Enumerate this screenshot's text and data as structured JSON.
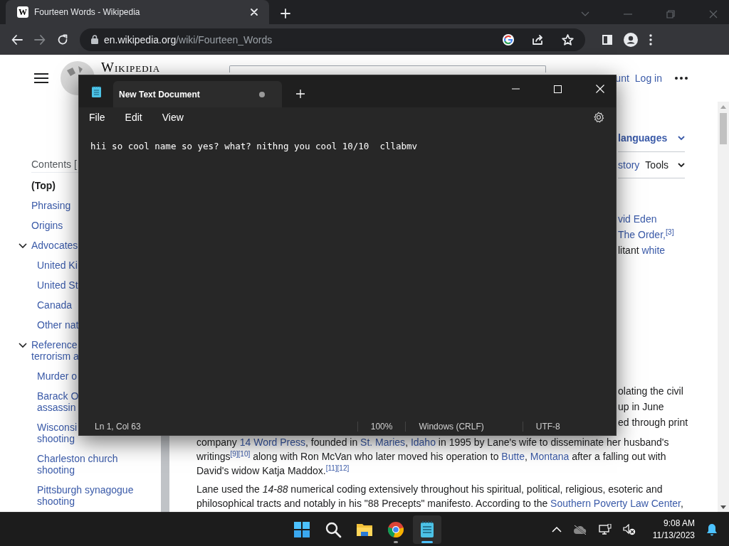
{
  "browser": {
    "tabs": [
      {
        "favicon_letter": "W",
        "title": "Fourteen Words - Wikipedia",
        "selected": true
      }
    ],
    "forward_disabled": true,
    "address": {
      "host": "en.wikipedia.org",
      "path": "/wiki/Fourteen_Words"
    }
  },
  "wiki": {
    "wordmark": "Wikipedia",
    "header_links": [
      "unt",
      "Log in"
    ],
    "languages": "languages",
    "history": "story",
    "tools": "Tools",
    "contents_heading": "Contents [",
    "toc": [
      {
        "label": "(Top)",
        "selected": true
      },
      {
        "label": "Phrasing",
        "selected": false
      },
      {
        "label": "Origins",
        "selected": false
      },
      {
        "label": "Advocates",
        "selected": false,
        "expanded": true,
        "children": [
          {
            "label": "United Ki",
            "selected": false
          },
          {
            "label": "United St",
            "selected": false
          },
          {
            "label": "Canada",
            "selected": false
          },
          {
            "label": "Other nat",
            "selected": false
          }
        ]
      },
      {
        "label": "Reference\nterrorism a",
        "selected": false,
        "expanded": true,
        "children": [
          {
            "label": "Murder o",
            "selected": false
          },
          {
            "label": "Barack O\nassassin",
            "selected": false
          },
          {
            "label": "Wisconsi\nshooting",
            "selected": false
          },
          {
            "label": "Charleston church\nshooting",
            "selected": false
          },
          {
            "label": "Pittsburgh synagogue\nshooting",
            "selected": false
          }
        ]
      }
    ],
    "fragments_top": [
      [
        {
          "text": "vid Eden",
          "link": true
        }
      ],
      [
        {
          "text": "The Order,",
          "link": true
        },
        {
          "text": "$^{[3]}$",
          "link": true
        }
      ],
      [
        {
          "text": "litant ",
          "link": false
        },
        {
          "text": "white",
          "link": true
        }
      ]
    ],
    "fragments_right": [
      "olating the civil",
      "up in June",
      "ed through print"
    ],
    "paragraphs": [
      [
        {
          "text": "company ",
          "link": false
        },
        {
          "text": "14 Word Press",
          "link": true
        },
        {
          "text": ", founded in ",
          "link": false
        },
        {
          "text": "St. Maries",
          "link": true
        },
        {
          "text": ", ",
          "link": false
        },
        {
          "text": "Idaho",
          "link": true
        },
        {
          "text": " in 1995 by Lane's wife to disseminate her husband's writings",
          "link": false
        },
        {
          "text": "$^{[9]}$",
          "link": true
        },
        {
          "text": "$^{[10]}$",
          "link": true
        },
        {
          "text": " along with Ron McVan who later moved his operation to ",
          "link": false
        },
        {
          "text": "Butte",
          "link": true
        },
        {
          "text": ", ",
          "link": false
        },
        {
          "text": "Montana",
          "link": true
        },
        {
          "text": " after a falling out with David's widow Katja Maddox.",
          "link": false
        },
        {
          "text": "$^{[11]}$",
          "link": true
        },
        {
          "text": "$^{[12]}$",
          "link": true
        }
      ],
      [
        {
          "text": "Lane used the *14-88* numerical coding extensively throughout his spiritual, political, religious, esoteric and philosophical tracts and notably in his \"88 Precepts\" manifesto. According to the ",
          "link": false
        },
        {
          "text": "Southern Poverty Law Center",
          "link": true
        },
        {
          "text": ",",
          "link": false
        }
      ]
    ]
  },
  "notepad": {
    "tab_title": "New Text Document",
    "unsaved": true,
    "menu": [
      "File",
      "Edit",
      "View"
    ],
    "text": "hii so cool name so yes? what? nithng you cool 10/10  cllabmv",
    "status": [
      "Ln 1, Col 63",
      "100%",
      "Windows (CRLF)",
      "UTF-8"
    ]
  },
  "taskbar": {
    "apps": [
      {
        "kind": "start",
        "running": false,
        "active": false
      },
      {
        "kind": "search",
        "running": false,
        "active": false
      },
      {
        "kind": "folder",
        "running": false,
        "active": false
      },
      {
        "kind": "chrome",
        "running": true,
        "active": false
      },
      {
        "kind": "notepad",
        "running": true,
        "active": true
      }
    ],
    "tray": [
      {
        "kind": "chevron"
      },
      {
        "kind": "cloud"
      },
      {
        "kind": "network"
      },
      {
        "kind": "volume"
      }
    ],
    "time": "9:08 AM",
    "date": "11/13/2023"
  }
}
